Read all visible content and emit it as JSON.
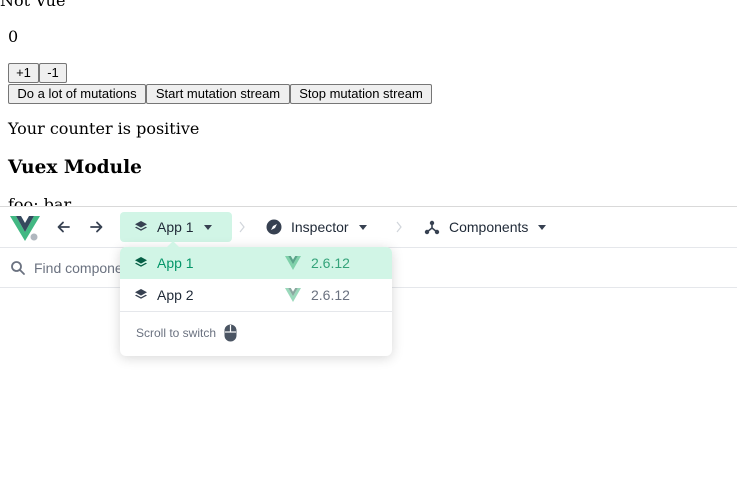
{
  "page": {
    "title": "Not Vue",
    "counter": "0",
    "buttons": {
      "increment": "+1",
      "decrement": "-1",
      "lots": "Do a lot of mutations",
      "start_stream": "Start mutation stream",
      "stop_stream": "Stop mutation stream"
    },
    "message": "Your counter is positive",
    "module_heading": "Vuex Module",
    "foo_line": "foo: bar"
  },
  "devtools": {
    "toolbar": {
      "app_crumb": "App 1",
      "inspector_crumb": "Inspector",
      "components_crumb": "Components"
    },
    "search": {
      "placeholder": "Find components..."
    },
    "app_menu": {
      "items": [
        {
          "name": "App 1",
          "version": "2.6.12",
          "selected": true
        },
        {
          "name": "App 2",
          "version": "2.6.12",
          "selected": false
        }
      ],
      "hint": "Scroll to switch"
    },
    "colors": {
      "accent": "#059669",
      "accent_bg": "#d1f5e6",
      "vue_green": "#42b883",
      "vue_dark": "#35495e"
    }
  }
}
